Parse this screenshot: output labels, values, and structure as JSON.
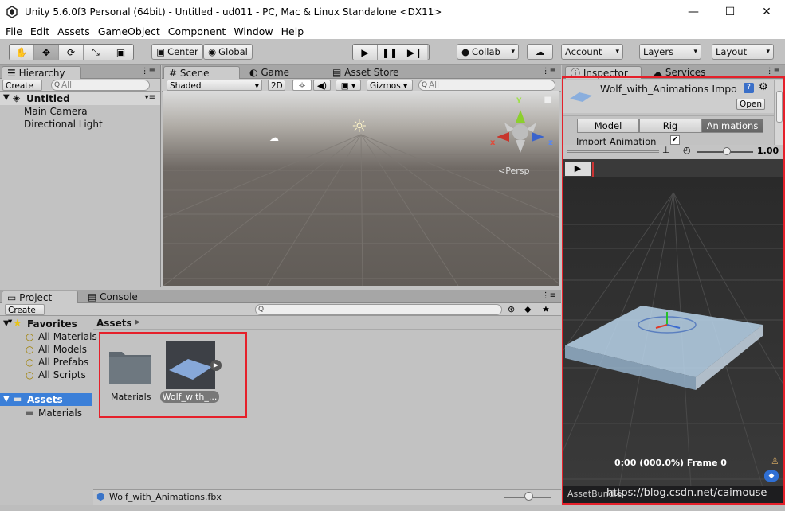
{
  "window": {
    "title": "Unity 5.6.0f3 Personal (64bit) - Untitled - ud011 - PC, Mac & Linux Standalone <DX11>",
    "minimize": "—",
    "maximize": "☐",
    "close": "✕"
  },
  "menu": [
    "File",
    "Edit",
    "Assets",
    "GameObject",
    "Component",
    "Window",
    "Help"
  ],
  "toolbar": {
    "center": "Center",
    "global": "Global",
    "collab": "Collab",
    "account": "Account",
    "layers": "Layers",
    "layout": "Layout"
  },
  "hierarchy": {
    "tab": "Hierarchy",
    "create": "Create",
    "search_placeholder": "All",
    "scene": "Untitled",
    "items": [
      "Main Camera",
      "Directional Light"
    ]
  },
  "scene_view": {
    "tabs": [
      "Scene",
      "Game",
      "Asset Store"
    ],
    "shading": "Shaded",
    "mode2d": "2D",
    "gizmos": "Gizmos",
    "search_placeholder": "All",
    "persp": "Persp",
    "axes": {
      "x": "x",
      "y": "y",
      "z": "z"
    }
  },
  "project": {
    "tabs": [
      "Project",
      "Console"
    ],
    "create": "Create",
    "favorites_label": "Favorites",
    "favorites": [
      "All Materials",
      "All Models",
      "All Prefabs",
      "All Scripts"
    ],
    "assets_label": "Assets",
    "asset_folders": [
      "Materials"
    ],
    "breadcrumb": "Assets",
    "items": [
      {
        "name": "Materials"
      },
      {
        "name": "Wolf_with_..."
      }
    ],
    "status_file": "Wolf_with_Animations.fbx"
  },
  "inspector": {
    "tabs": [
      "Inspector",
      "Services"
    ],
    "title": "Wolf_with_Animations Impo",
    "open": "Open",
    "subtabs": [
      "Model",
      "Rig",
      "Animations"
    ],
    "active_subtab": "Animations",
    "import_animation_label": "Import Animation",
    "import_animation_checked": true,
    "speed": "1.00",
    "frame_text": "0:00 (000.0%) Frame 0",
    "asset_bundle": "AssetBundle",
    "watermark": "https://blog.csdn.net/caimouse"
  }
}
